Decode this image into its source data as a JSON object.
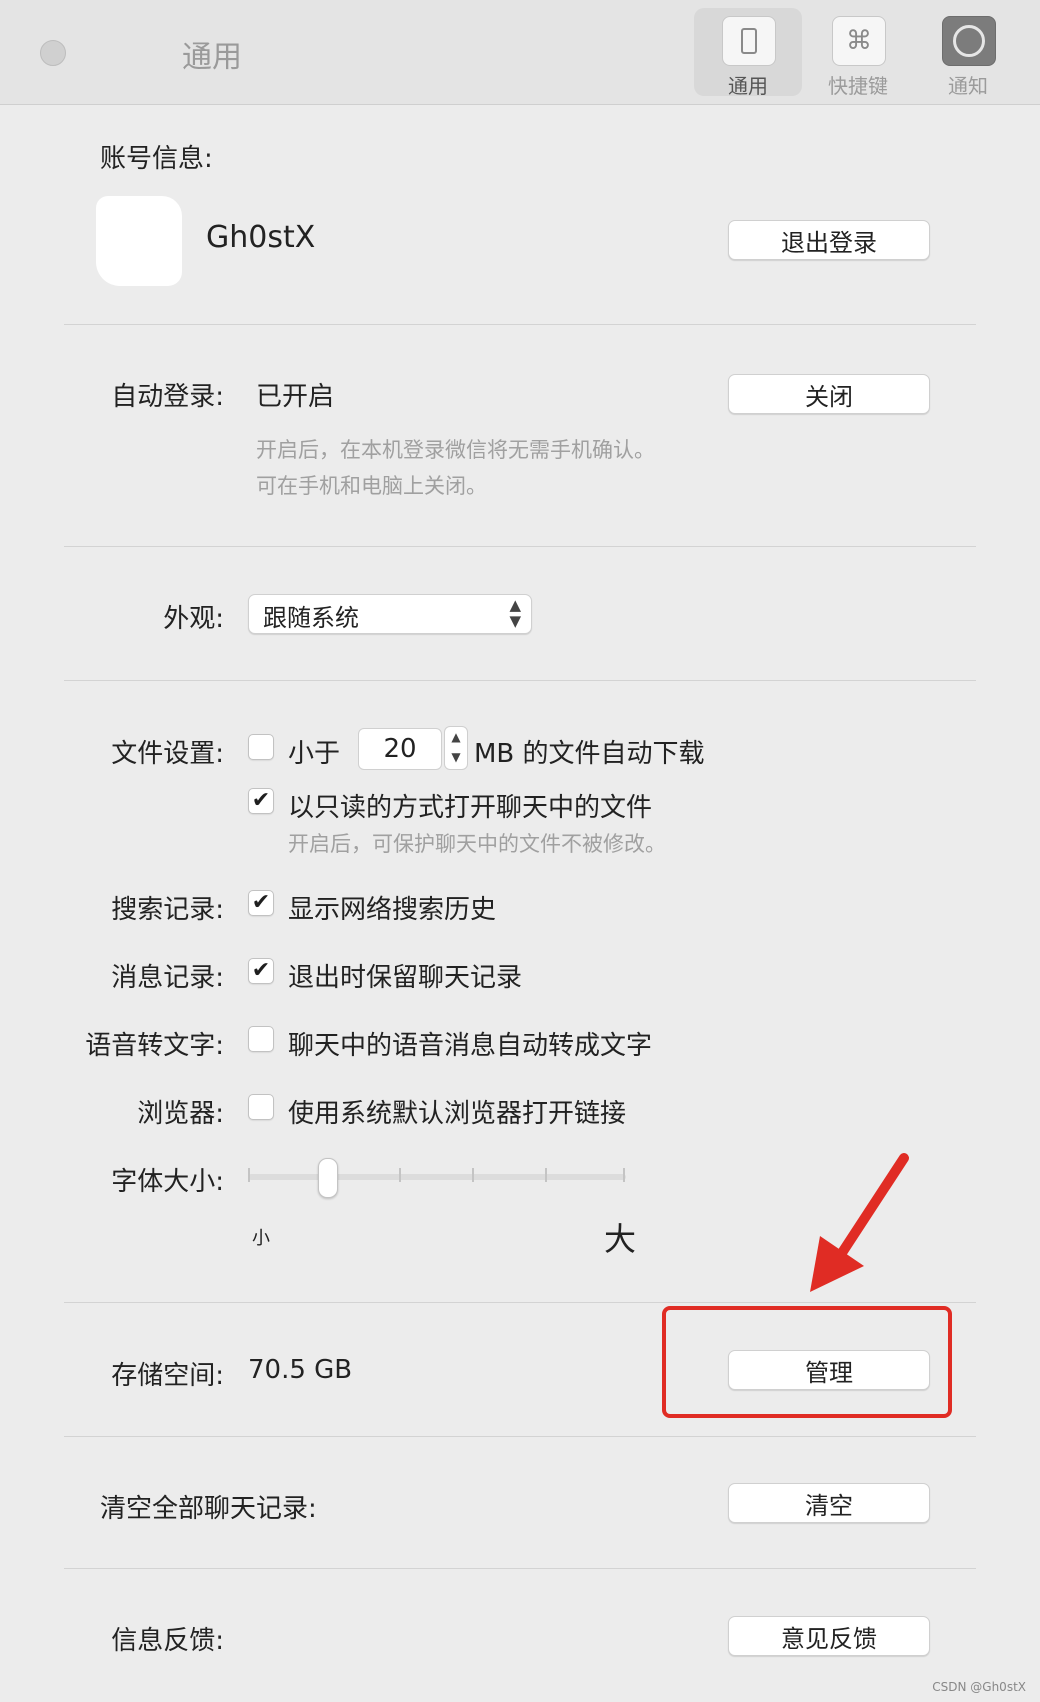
{
  "window": {
    "title": "通用"
  },
  "toolbar": {
    "items": [
      {
        "label": "通用",
        "icon": "phone-icon"
      },
      {
        "label": "快捷键",
        "icon": "command-key-icon",
        "glyph": "⌘"
      },
      {
        "label": "通知",
        "icon": "notification-icon"
      }
    ]
  },
  "account": {
    "label": "账号信息:",
    "username": "Gh0stX",
    "logout_button": "退出登录"
  },
  "auto_login": {
    "label": "自动登录:",
    "status": "已开启",
    "close_button": "关闭",
    "hint_line1": "开启后，在本机登录微信将无需手机确认。",
    "hint_line2": "可在手机和电脑上关闭。"
  },
  "appearance": {
    "label": "外观:",
    "selected": "跟随系统"
  },
  "file_settings": {
    "label": "文件设置:",
    "auto_download_prefix": "小于",
    "auto_download_size": "20",
    "auto_download_suffix": "MB 的文件自动下载",
    "auto_download_checked": false,
    "readonly_label": "以只读的方式打开聊天中的文件",
    "readonly_checked": true,
    "readonly_hint": "开启后，可保护聊天中的文件不被修改。"
  },
  "search_history": {
    "label": "搜索记录:",
    "option": "显示网络搜索历史",
    "checked": true
  },
  "message_history": {
    "label": "消息记录:",
    "option": "退出时保留聊天记录",
    "checked": true
  },
  "speech_to_text": {
    "label": "语音转文字:",
    "option": "聊天中的语音消息自动转成文字",
    "checked": false
  },
  "browser": {
    "label": "浏览器:",
    "option": "使用系统默认浏览器打开链接",
    "checked": false
  },
  "font_size": {
    "label": "字体大小:",
    "small_label": "小",
    "large_label": "大",
    "level": 2,
    "levels": 6
  },
  "storage": {
    "label": "存储空间:",
    "value": "70.5 GB",
    "manage_button": "管理"
  },
  "clear_history": {
    "label": "清空全部聊天记录:",
    "clear_button": "清空"
  },
  "feedback": {
    "label": "信息反馈:",
    "feedback_button": "意见反馈"
  },
  "watermark": "CSDN @Gh0stX",
  "colors": {
    "annotation_red": "#e02c24",
    "background": "#ececec"
  }
}
